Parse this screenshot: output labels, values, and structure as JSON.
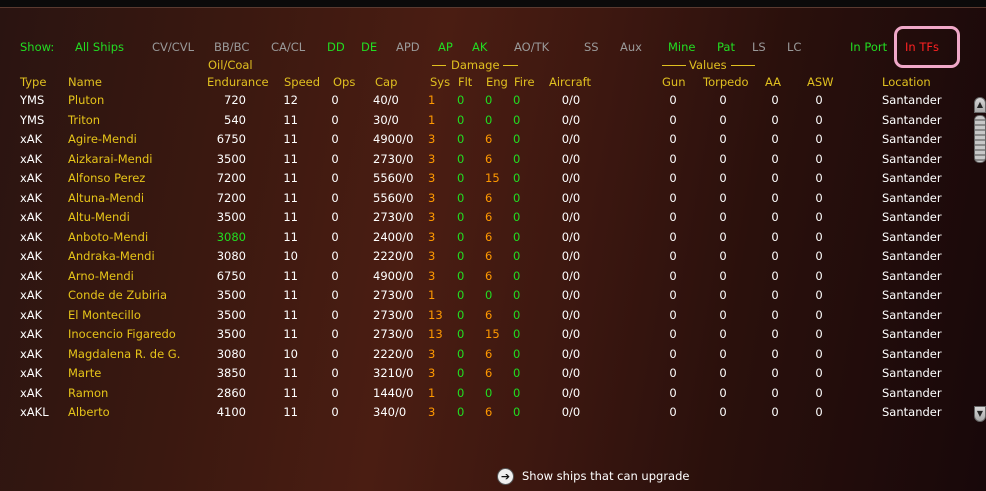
{
  "filters": {
    "show_label": "Show:",
    "all_ships": "All Ships",
    "cv_cvl": "CV/CVL",
    "bb_bc": "BB/BC",
    "ca_cl": "CA/CL",
    "dd": "DD",
    "de": "DE",
    "apd": "APD",
    "ap": "AP",
    "ak": "AK",
    "ao_tk": "AO/TK",
    "ss": "SS",
    "aux": "Aux",
    "mine": "Mine",
    "pat": "Pat",
    "ls": "LS",
    "lc": "LC",
    "in_port": "In Port",
    "in_tfs": "In TFs"
  },
  "headers": {
    "type": "Type",
    "name": "Name",
    "oil_coal": "Oil/Coal",
    "endurance": "Endurance",
    "speed": "Speed",
    "ops": "Ops",
    "cap": "Cap",
    "damage": "Damage",
    "sys": "Sys",
    "flt": "Flt",
    "eng": "Eng",
    "fire": "Fire",
    "aircraft": "Aircraft",
    "values": "Values",
    "gun": "Gun",
    "torpedo": "Torpedo",
    "aa": "AA",
    "asw": "ASW",
    "location": "Location"
  },
  "colors": {
    "header_yellow": "#e0c020",
    "name_yellow": "#e6c419",
    "active_green": "#22dd22",
    "inactive_gray": "#9a9a9a",
    "sys_orange": "#ff9900",
    "in_tfs_red": "#ff2222",
    "highlight_pink": "#f0a8c8"
  },
  "ships": [
    {
      "type": "YMS",
      "name": "Pluton",
      "endurance": "720",
      "speed": "12",
      "ops": "0",
      "cap": "40/0",
      "sys": "1",
      "flt": "0",
      "eng": "0",
      "fire": "0",
      "aircraft": "0/0",
      "gun": "0",
      "torpedo": "0",
      "aa": "0",
      "asw": "0",
      "location": "Santander"
    },
    {
      "type": "YMS",
      "name": "Triton",
      "endurance": "540",
      "speed": "11",
      "ops": "0",
      "cap": "30/0",
      "sys": "1",
      "flt": "0",
      "eng": "0",
      "fire": "0",
      "aircraft": "0/0",
      "gun": "0",
      "torpedo": "0",
      "aa": "0",
      "asw": "0",
      "location": "Santander"
    },
    {
      "type": "xAK",
      "name": "Agire-Mendi",
      "endurance": "6750",
      "speed": "11",
      "ops": "0",
      "cap": "4900/0",
      "sys": "3",
      "flt": "0",
      "eng": "6",
      "fire": "0",
      "aircraft": "0/0",
      "gun": "0",
      "torpedo": "0",
      "aa": "0",
      "asw": "0",
      "location": "Santander"
    },
    {
      "type": "xAK",
      "name": "Aizkarai-Mendi",
      "endurance": "3500",
      "speed": "11",
      "ops": "0",
      "cap": "2730/0",
      "sys": "3",
      "flt": "0",
      "eng": "6",
      "fire": "0",
      "aircraft": "0/0",
      "gun": "0",
      "torpedo": "0",
      "aa": "0",
      "asw": "0",
      "location": "Santander"
    },
    {
      "type": "xAK",
      "name": "Alfonso Perez",
      "endurance": "7200",
      "speed": "11",
      "ops": "0",
      "cap": "5560/0",
      "sys": "3",
      "flt": "0",
      "eng": "15",
      "fire": "0",
      "aircraft": "0/0",
      "gun": "0",
      "torpedo": "0",
      "aa": "0",
      "asw": "0",
      "location": "Santander"
    },
    {
      "type": "xAK",
      "name": "Altuna-Mendi",
      "endurance": "7200",
      "speed": "11",
      "ops": "0",
      "cap": "5560/0",
      "sys": "3",
      "flt": "0",
      "eng": "6",
      "fire": "0",
      "aircraft": "0/0",
      "gun": "0",
      "torpedo": "0",
      "aa": "0",
      "asw": "0",
      "location": "Santander"
    },
    {
      "type": "xAK",
      "name": "Altu-Mendi",
      "endurance": "3500",
      "speed": "11",
      "ops": "0",
      "cap": "2730/0",
      "sys": "3",
      "flt": "0",
      "eng": "6",
      "fire": "0",
      "aircraft": "0/0",
      "gun": "0",
      "torpedo": "0",
      "aa": "0",
      "asw": "0",
      "location": "Santander"
    },
    {
      "type": "xAK",
      "name": "Anboto-Mendi",
      "endurance": "3080",
      "endurance_low": true,
      "speed": "11",
      "ops": "0",
      "cap": "2400/0",
      "sys": "3",
      "flt": "0",
      "eng": "6",
      "fire": "0",
      "aircraft": "0/0",
      "gun": "0",
      "torpedo": "0",
      "aa": "0",
      "asw": "0",
      "location": "Santander"
    },
    {
      "type": "xAK",
      "name": "Andraka-Mendi",
      "endurance": "3080",
      "speed": "10",
      "ops": "0",
      "cap": "2220/0",
      "sys": "3",
      "flt": "0",
      "eng": "6",
      "fire": "0",
      "aircraft": "0/0",
      "gun": "0",
      "torpedo": "0",
      "aa": "0",
      "asw": "0",
      "location": "Santander"
    },
    {
      "type": "xAK",
      "name": "Arno-Mendi",
      "endurance": "6750",
      "speed": "11",
      "ops": "0",
      "cap": "4900/0",
      "sys": "3",
      "flt": "0",
      "eng": "6",
      "fire": "0",
      "aircraft": "0/0",
      "gun": "0",
      "torpedo": "0",
      "aa": "0",
      "asw": "0",
      "location": "Santander"
    },
    {
      "type": "xAK",
      "name": "Conde de Zubiria",
      "endurance": "3500",
      "speed": "11",
      "ops": "0",
      "cap": "2730/0",
      "sys": "1",
      "flt": "0",
      "eng": "0",
      "fire": "0",
      "aircraft": "0/0",
      "gun": "0",
      "torpedo": "0",
      "aa": "0",
      "asw": "0",
      "location": "Santander"
    },
    {
      "type": "xAK",
      "name": "El Montecillo",
      "endurance": "3500",
      "speed": "11",
      "ops": "0",
      "cap": "2730/0",
      "sys": "13",
      "flt": "0",
      "eng": "6",
      "fire": "0",
      "aircraft": "0/0",
      "gun": "0",
      "torpedo": "0",
      "aa": "0",
      "asw": "0",
      "location": "Santander"
    },
    {
      "type": "xAK",
      "name": "Inocencio Figaredo",
      "endurance": "3500",
      "speed": "11",
      "ops": "0",
      "cap": "2730/0",
      "sys": "13",
      "flt": "0",
      "eng": "15",
      "fire": "0",
      "aircraft": "0/0",
      "gun": "0",
      "torpedo": "0",
      "aa": "0",
      "asw": "0",
      "location": "Santander"
    },
    {
      "type": "xAK",
      "name": "Magdalena R. de G.",
      "endurance": "3080",
      "speed": "10",
      "ops": "0",
      "cap": "2220/0",
      "sys": "3",
      "flt": "0",
      "eng": "6",
      "fire": "0",
      "aircraft": "0/0",
      "gun": "0",
      "torpedo": "0",
      "aa": "0",
      "asw": "0",
      "location": "Santander"
    },
    {
      "type": "xAK",
      "name": "Marte",
      "endurance": "3850",
      "speed": "11",
      "ops": "0",
      "cap": "3210/0",
      "sys": "3",
      "flt": "0",
      "eng": "6",
      "fire": "0",
      "aircraft": "0/0",
      "gun": "0",
      "torpedo": "0",
      "aa": "0",
      "asw": "0",
      "location": "Santander"
    },
    {
      "type": "xAK",
      "name": "Ramon",
      "endurance": "2860",
      "speed": "11",
      "ops": "0",
      "cap": "1440/0",
      "sys": "1",
      "flt": "0",
      "eng": "0",
      "fire": "0",
      "aircraft": "0/0",
      "gun": "0",
      "torpedo": "0",
      "aa": "0",
      "asw": "0",
      "location": "Santander"
    },
    {
      "type": "xAKL",
      "name": "Alberto",
      "endurance": "4100",
      "speed": "11",
      "ops": "0",
      "cap": "340/0",
      "sys": "3",
      "flt": "0",
      "eng": "6",
      "fire": "0",
      "aircraft": "0/0",
      "gun": "0",
      "torpedo": "0",
      "aa": "0",
      "asw": "0",
      "location": "Santander"
    }
  ],
  "footer": {
    "upgrade_label": "Show ships that can upgrade"
  },
  "icons": {
    "upgrade": "arrow-right-icon",
    "scroll_up": "chevron-up-icon",
    "scroll_down": "chevron-down-icon"
  }
}
